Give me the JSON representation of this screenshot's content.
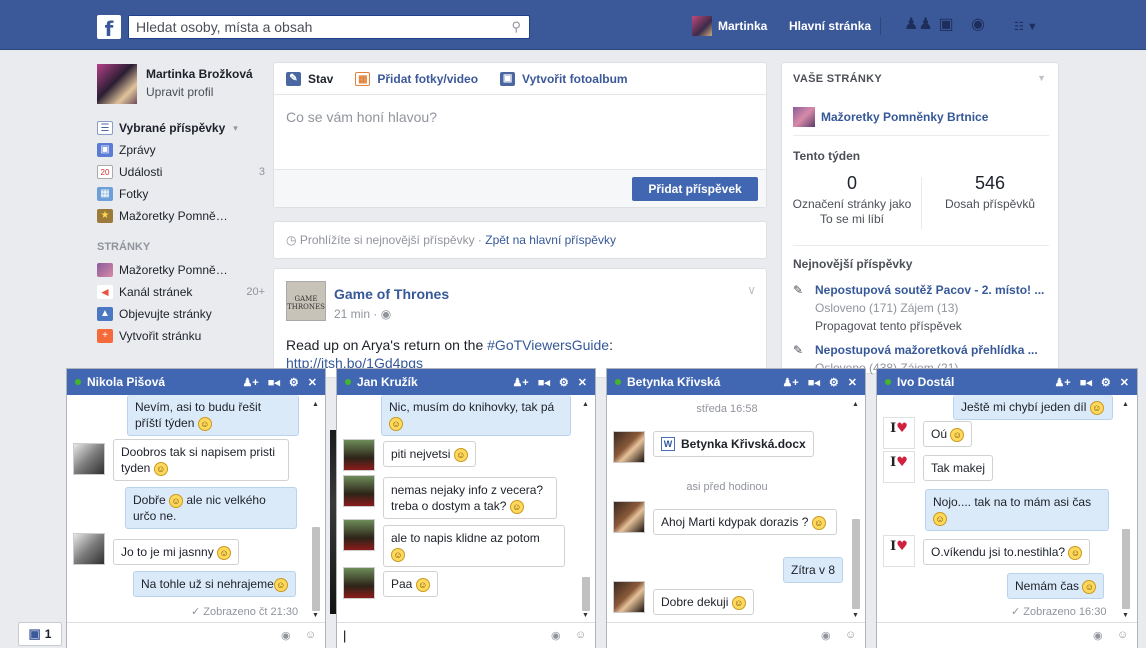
{
  "topbar": {
    "logo": "f",
    "search_placeholder": "Hledat osoby, místa a obsah",
    "user_name": "Martinka",
    "home_label": "Hlavní stránka"
  },
  "left": {
    "profile_name": "Martinka Brožková",
    "profile_edit": "Upravit profil",
    "items": [
      {
        "label": "Vybrané příspěvky",
        "extra": "▾"
      },
      {
        "label": "Zprávy",
        "extra": ""
      },
      {
        "label": "Události",
        "extra": "3"
      },
      {
        "label": "Fotky",
        "extra": ""
      },
      {
        "label": "Mažoretky Pomně…",
        "extra": ""
      }
    ],
    "pages_header": "STRÁNKY",
    "pages": [
      {
        "label": "Mažoretky Pomně…",
        "extra": ""
      },
      {
        "label": "Kanál stránek",
        "extra": "20+"
      },
      {
        "label": "Objevujte stránky",
        "extra": ""
      },
      {
        "label": "Vytvořit stránku",
        "extra": ""
      }
    ]
  },
  "composer": {
    "tab_status": "Stav",
    "tab_photo": "Přidat fotky/video",
    "tab_album": "Vytvořit fotoalbum",
    "placeholder": "Co se vám honí hlavou?",
    "post_button": "Přidat příspěvek"
  },
  "recent": {
    "text": "Prohlížíte si nejnovější příspěvky · ",
    "link": "Zpět na hlavní příspěvky"
  },
  "post": {
    "page_name": "Game of Thrones",
    "time": "21 min · ",
    "logo_text": "GAME THRONES",
    "text_before": "Read up on Arya's return on the ",
    "hashtag": "#GoTViewersGuide",
    "text_after": ":",
    "link": "http://itsh.bo/1Gd4pgs"
  },
  "right": {
    "header": "VAŠE STRÁNKY",
    "page_name": "Mažoretky Pomněnky Brtnice",
    "week_label": "Tento týden",
    "stat1_value": "0",
    "stat1_label": "Označení stránky jako To se mi líbí",
    "stat2_value": "546",
    "stat2_label": "Dosah příspěvků",
    "recent_header": "Nejnovější příspěvky",
    "posts": [
      {
        "title": "Nepostupová soutěž Pacov - 2. místo! ...",
        "stats": "Osloveno (171) Zájem (13)",
        "promote": "Propagovat tento příspěvek"
      },
      {
        "title": "Nepostupová mažoretková přehlídka ...",
        "stats": "Osloveno (438) Zájem (21)",
        "promote": ""
      }
    ]
  },
  "chats": [
    {
      "name": "Nikola Pišová",
      "messages": [
        {
          "text": "Nevím, asi to budu řešit příští týden",
          "emoji": "☺",
          "side": "out"
        },
        {
          "text": "Doobros tak si napisem pristi tyden",
          "emoji": "☺",
          "side": "in"
        },
        {
          "text": "Dobře ",
          "emoji": "☺",
          "text2": " ale nic velkého určo ne.",
          "side": "out"
        },
        {
          "text": "Jo to je mi jasnny",
          "emoji": "☺",
          "side": "in"
        },
        {
          "text": "Na tohle už si nehrajeme",
          "emoji": "☺",
          "side": "out"
        }
      ],
      "seen": "✓ Zobrazeno čt 21:30"
    },
    {
      "name": "Jan Kružík",
      "messages": [
        {
          "text": "Nic, musím do knihovky, tak pá",
          "emoji": "☺",
          "side": "out"
        },
        {
          "text": "piti nejvetsi",
          "emoji": "☺",
          "side": "in"
        },
        {
          "text": "nemas nejaky info z vecera? treba o dostym a tak?",
          "emoji": "☺",
          "side": "in"
        },
        {
          "text": "ale to napis klidne az potom",
          "emoji": "☺",
          "side": "in"
        },
        {
          "text": "Paa",
          "emoji": "☺",
          "side": "in"
        }
      ]
    },
    {
      "name": "Betynka Křivská",
      "day": "středa 16:58",
      "file": "Betynka Křivská.docx",
      "ago": "asi před hodinou",
      "messages": [
        {
          "text": "Ahoj Marti kdypak dorazis ?",
          "emoji": "☺",
          "side": "in"
        },
        {
          "text": "Zítra v 8",
          "emoji": "",
          "side": "out"
        },
        {
          "text": "Dobre dekuji",
          "emoji": "☺",
          "side": "in"
        }
      ]
    },
    {
      "name": "Ivo Dostál",
      "avatar_text": "I",
      "messages": [
        {
          "text": "Ještě mi chybí jeden díl",
          "emoji": "☺",
          "side": "out"
        },
        {
          "text": "Oú",
          "emoji": "☺",
          "side": "in"
        },
        {
          "text": "Tak makej",
          "emoji": "",
          "side": "in"
        },
        {
          "text": "Nojo.... tak na to mám asi čas",
          "emoji": "☺",
          "side": "out"
        },
        {
          "text": "O.víkendu jsi to.nestihla?",
          "emoji": "☺",
          "side": "in"
        },
        {
          "text": "Nemám čas",
          "emoji": "☺",
          "side": "out"
        }
      ],
      "seen": "✓ Zobrazeno 16:30"
    }
  ],
  "messages_button": "1",
  "colors": {
    "brand": "#3b5998",
    "chat_header": "#4267b2",
    "button": "#4267b2",
    "link": "#365899"
  }
}
